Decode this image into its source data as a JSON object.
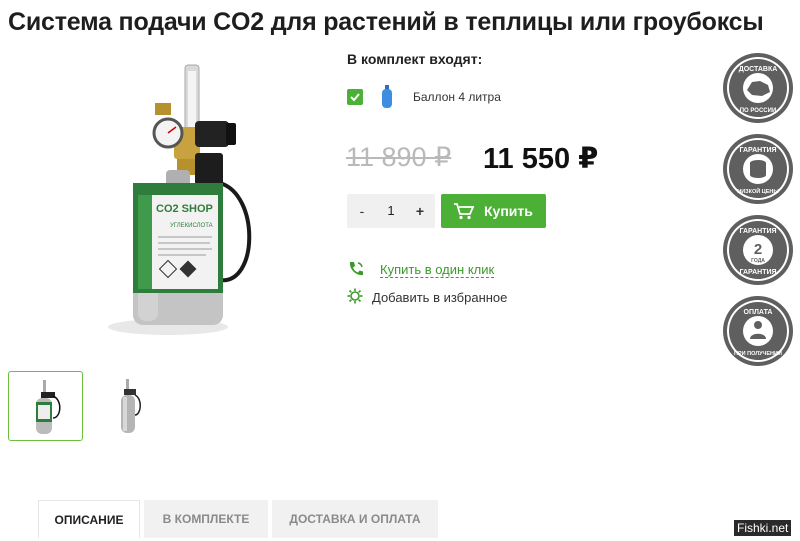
{
  "page": {
    "title": "Система подачи CO2 для растений в теплицы или гроубоксы"
  },
  "product_image": {
    "label_brand": "CO2 SHOP",
    "label_line": "УГЛЕКИСЛОТА"
  },
  "kit": {
    "heading": "В комплект входят:",
    "items": [
      {
        "label": "Баллон 4 литра",
        "checked": true,
        "icon": "gas-cylinder-icon"
      }
    ]
  },
  "price": {
    "old": "11 890 ₽",
    "new": "11 550 ₽"
  },
  "quantity": {
    "minus": "-",
    "value": "1",
    "plus": "+"
  },
  "buy": {
    "label": "Купить",
    "icon": "cart-icon"
  },
  "links": {
    "one_click": "Купить в один клик",
    "favorite": "Добавить в избранное"
  },
  "badges": [
    {
      "name": "delivery-badge",
      "top_text": "ДОСТАВКА",
      "bottom_text": "ПО РОССИИ"
    },
    {
      "name": "low-price-badge",
      "top_text": "ГАРАНТИЯ",
      "bottom_text": "НИЗКОЙ ЦЕНЫ"
    },
    {
      "name": "warranty-badge",
      "top_text": "ГАРАНТИЯ",
      "center_number": "2",
      "center_text": "ГОДА",
      "bottom_text": "ГАРАНТИЯ"
    },
    {
      "name": "payment-badge",
      "top_text": "ОПЛАТА",
      "bottom_text": "ПРИ ПОЛУЧЕНИИ"
    }
  ],
  "tabs": [
    {
      "label": "ОПИСАНИЕ",
      "active": true
    },
    {
      "label": "В КОМПЛЕКТЕ",
      "active": false
    },
    {
      "label": "ДОСТАВКА И ОПЛАТА",
      "active": false
    }
  ],
  "watermark": "Fishki.net",
  "colors": {
    "accent": "#4caf36",
    "link": "#3a9a2a",
    "badge": "#5f5f5f"
  }
}
